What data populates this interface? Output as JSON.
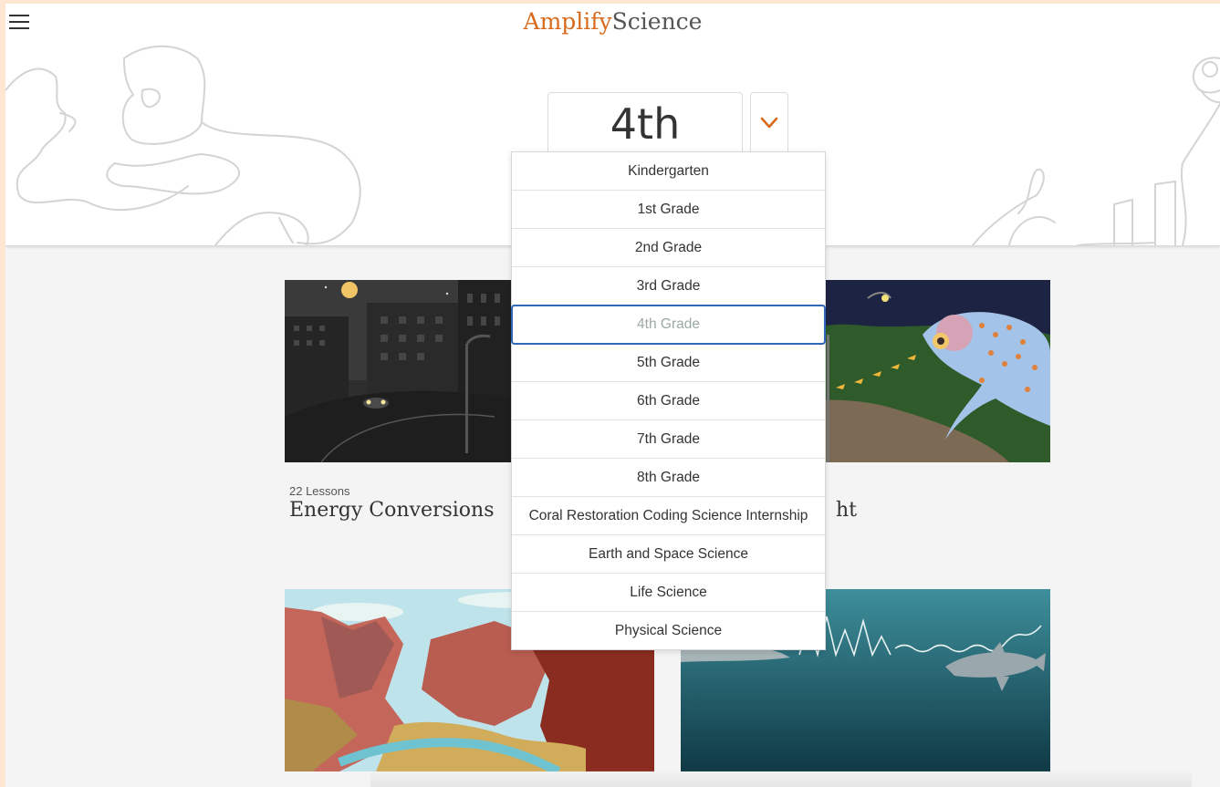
{
  "header": {
    "brand_part1": "Amplify",
    "brand_part2": "Science",
    "selected_grade": "4th Grade"
  },
  "grade_options": [
    "Kindergarten",
    "1st Grade",
    "2nd Grade",
    "3rd Grade",
    "4th Grade",
    "5th Grade",
    "6th Grade",
    "7th Grade",
    "8th Grade",
    "Coral Restoration Coding Science Internship",
    "Earth and Space Science",
    "Life Science",
    "Physical Science"
  ],
  "selected_option_index": 4,
  "units": [
    {
      "lessons": "22 Lessons",
      "title": "Energy Conversions"
    },
    {
      "lessons": "",
      "title": "ht"
    },
    {
      "lessons": "",
      "title": ""
    },
    {
      "lessons": "",
      "title": ""
    }
  ],
  "colors": {
    "accent": "#d86a1c",
    "selection_outline": "#2f68b8",
    "background": "#f4f4f4"
  }
}
